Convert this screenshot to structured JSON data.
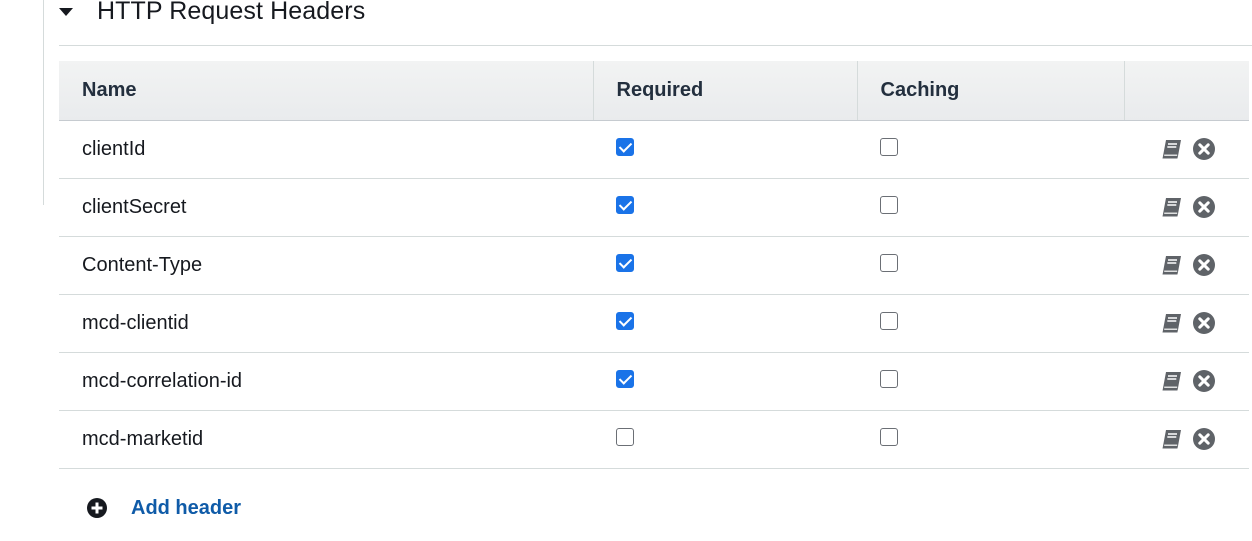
{
  "section": {
    "title": "HTTP Request Headers",
    "expanded": true
  },
  "table": {
    "columns": {
      "name": "Name",
      "required": "Required",
      "caching": "Caching",
      "actions": ""
    },
    "rows": [
      {
        "name": "clientId",
        "required": true,
        "caching": false
      },
      {
        "name": "clientSecret",
        "required": true,
        "caching": false
      },
      {
        "name": "Content-Type",
        "required": true,
        "caching": false
      },
      {
        "name": "mcd-clientid",
        "required": true,
        "caching": false
      },
      {
        "name": "mcd-correlation-id",
        "required": true,
        "caching": false
      },
      {
        "name": "mcd-marketid",
        "required": false,
        "caching": false
      }
    ],
    "row_actions": {
      "edit_icon": "book-edit-icon",
      "remove_icon": "remove-circle-icon"
    }
  },
  "add_header": {
    "label": "Add header",
    "icon": "plus-circle-icon"
  },
  "colors": {
    "checkbox_checked": "#1a73e8",
    "link": "#0f5ba8",
    "icon_gray": "#5f6368"
  }
}
